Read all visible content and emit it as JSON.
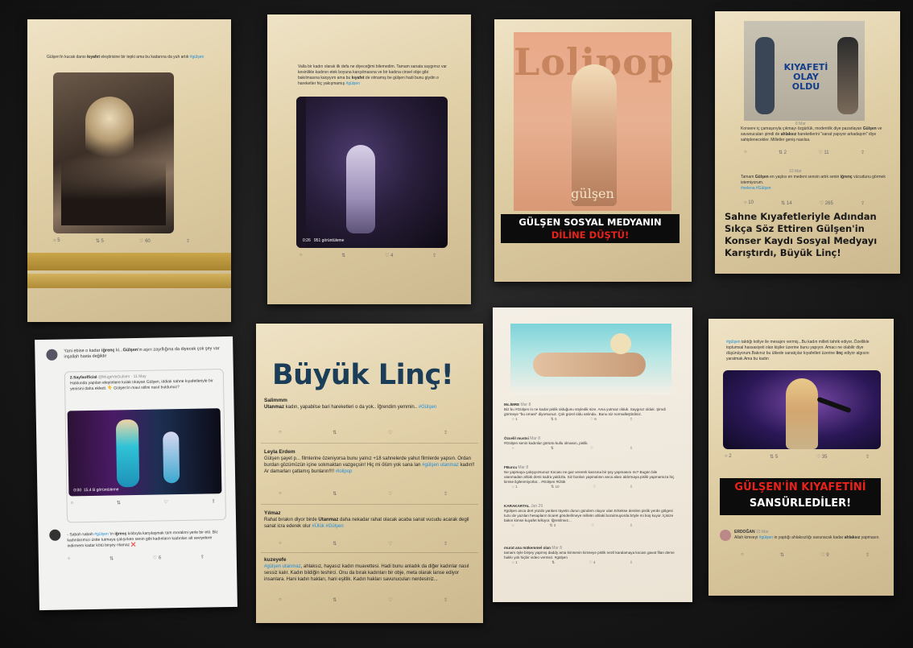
{
  "card1": {
    "tweet_pre": "Gülşen'in kucak dansı ",
    "tweet_bold": "kıyafet",
    "tweet_post": " eleştirisine bir tepki ama bu kadarına da yuh artık ",
    "hashtag": "#gülşen",
    "actions": [
      "5",
      "5",
      "60"
    ]
  },
  "card2": {
    "tweet_a": "Valla bir kadın olarak ilk defa ne diyeceğimi bilemedim. Tamam sanata saygımız var kesinlikle kadının etek boyuna karışılmasına ve bir kadına cinsel obje gibi bakılmasına karşıyım ama bu ",
    "tweet_bold": "kıyafet",
    "tweet_b": " de olmamış be gülşen hadi bunu giydin o hareketler hiç yakışmamış ",
    "hashtag": "#gülşen",
    "video_time": "0:26",
    "video_views": "951 görüntüleme"
  },
  "card3": {
    "logo": "Lolipop",
    "artist": "gülşen",
    "headline_line1": "GÜLŞEN SOSYAL MEDYANIN",
    "headline_line2": "DİLİNE DÜŞTÜ!"
  },
  "card4": {
    "banner_line1": "KIYAFETİ",
    "banner_line2": "OLAY OLDU",
    "date1": "8 Mar",
    "tweet1_a": "Konsere iç çamaşırıyla çıkmayı özgürlük, modernlik diye pazarlayan ",
    "tweet1_name": "Gülşen",
    "tweet1_b": " ve savunucuları şimdi de ",
    "tweet1_bold": "ahlaksız",
    "tweet1_c": " hareketlerini \"sanat yapıyor arkadaşım\" diye sahiplenecekler. Milletler geniş nasılsa.",
    "actions1": [
      "2",
      "11",
      ""
    ],
    "date2": "10 Mar",
    "tweet2_a": "Tamam ",
    "tweet2_name": "Gülşen",
    "tweet2_b": " en yaşlısı en medeni sensin artık senin ",
    "tweet2_bold": "iğrenç",
    "tweet2_c": " vücudunu görmek istemiyorum.",
    "tweet2_tags": "#selena #Gülşen",
    "actions2": [
      "10",
      "14",
      "265"
    ],
    "headline": "Sahne Kıyafetleriyle Adından Sıkça Söz Ettiren Gülşen'in Konser Kaydı Sosyal Medyayı Karıştırdı, Büyük Linç!"
  },
  "card5": {
    "tweet_a": "Yani ebise o kadar ",
    "tweet_bold": "iğrenç",
    "tweet_b": " ki...",
    "tweet_name": "Gülşen",
    "tweet_c": "'in aşırı zayıflığına da diyecek çok şey var inşallah hasta değildir",
    "quote_user": "2.Sayfaofficial",
    "quote_handle": "@MugeVeGulsen · 11 May",
    "quote_text": "Hakkında yapılan eleştirilere kulak tıkayan Gülşen, iddialı sahne kıyafetleriyle bir yenisini daha ekledi. 👇 Gülşen'in mavi stilini nasıl buldunuz?",
    "video_time": "0:00",
    "video_views": "15,4 B görüntüleme",
    "reply_a": "- Sabah sabah ",
    "reply_tag": "#gülşen",
    "reply_b": " 'in ",
    "reply_bold": "iğrenç",
    "reply_c": " kılıbıyla karşılaşmak tüm moralimi yerle bir etti. Biz kadınlarımızı üstte tutmaya çalışırken senin gibi kadınların kadınları alt seviyelere indirmem kadar kötü birşey olamaz ❌",
    "reply_actions": [
      "",
      "",
      "6"
    ]
  },
  "card6": {
    "title": "Büyük Linç!",
    "posts": [
      {
        "name": "Salimmm",
        "bold": "Utanmaz",
        "text": " kadın, yapabilse bari hareketleri o da yok.. İğrendim yemmin.. ",
        "tag": "#Gülşen"
      },
      {
        "name": "Leyla Erdem",
        "bold": "",
        "text": "Gülşen şayet p... filmlerine özeniyorsa bunu yalnız +18 sahnelerde yahut filmlerde yapsın. Ordan burdan gözümüzün içine sokmaktan vazgeçsin! Hiç mi ölüm yok sana lan ",
        "tag": "#gülşen utanmaz",
        "text2": " kadın!! Ar damarları çatlamış bunların!!!! ",
        "tag2": "#lolipop"
      },
      {
        "name": "Yılmaz",
        "bold": "",
        "text": "Rahat bırakın diyor birde ",
        "bold2": "Utanmaz",
        "text2": " daha nekadar rahat olacak acaba sanat vucudu acarak degil sanat icra ederek olur ",
        "tag": "#Ülük #Gülşen"
      },
      {
        "name": "kuzeyefe",
        "bold": "",
        "tag": "#gülşen utanmaz",
        "text": ", ahlaksız, hayasız kadın muavettesi. Hadi bunu anladık da diğer kadınlar nasıl sessiz kalır. Kadın bildiğin teshirci. Onu da bırak kadınları bir obje, meta olarak lanse ediyor insanlara. Hani kadın hakları, hani eşitlik. Kadın hakları savunucuları nerdesiniz..."
      }
    ]
  },
  "card7": {
    "posts": [
      {
        "name": "Mc.İMRE",
        "date": "Mar 8",
        "text": "Biz bu #Gülşen in ne kadar pislik olduğunu söyledik size. Ama yutmaz olduk. Saygısız olduk. Şimdi görmeye \"bu ornasi\" diyorsunuz. Çok güzel oldu aslında.. Bunu siz normalleştirdiniz.",
        "actions": [
          "1",
          "5",
          "6"
        ]
      },
      {
        "name": "Özcelil mustsi",
        "date": "Mar 8",
        "text": "#Gülşen senin kadınlar görünü kullu olmasın, pislik.",
        "actions": [
          "",
          "",
          ""
        ]
      },
      {
        "name": "FBurcu",
        "date": "Mar 8",
        "text": "Ne yapmaya çalışıyorsunuz Kocası ne gaz vererek karısına bir şey yapmasını mı? Bugün bile utanmadan ahlak dersi sadra yaldızla. Siz bunları yapmalısın anca alanı aldırmaya pislik yapmamıza hiç kimse ilgilenmiyorlar... #Gülşen #Ülük",
        "actions": [
          "1",
          "10",
          ""
        ]
      },
      {
        "name": "KARAKARTAL",
        "date": "Jan 29",
        "text": "#gülşen anca dert yüzdü yanken tüyetin durun gündem oluyor ulan Erkekse denilen pislik yerde gölgesi tuzu de yazılan hesapların ticaret gönderilmeye milletin ahlaki bozulmuyorda böyle mi boş kuyor. İçinize bakın kimse kuyafet kılkıyor. İğrenilmez...",
        "actions": [
          "",
          "3",
          ""
        ]
      },
      {
        "name": "murat ana mükemmel olan",
        "date": "Mar 8",
        "text": "tamam öyle birşey yapmış daddy ama kimsenin kimseye pislik nezil karalamaya kocası gavat filan deme hakkı yok hiçbir video vermez. #gülşen",
        "actions": [
          "1",
          "",
          "4"
        ]
      }
    ]
  },
  "card8": {
    "tweet_a": "",
    "tweet_tag": "#gülşen",
    "tweet_b": " taktığı koliye ile mesajını vermiş...Bu kadın milleti tahrik ediyor..Özellikle toplumsal hassasiyeti olan kişiler üzerine bunu yapıyor. Amacı ne olabilir diye düşünüyorum.Bakınız bu ülkede sanatçılar kıyafetleri üzerine ",
    "tweet_bold": "linç",
    "tweet_c": " ediyor algısını yaratmak.Ama bu kadın",
    "actions": [
      "2",
      "5",
      "35"
    ],
    "headline_line1": "GÜLŞEN'İN KIYAFETİNİ",
    "headline_line2": "SANSÜRLEDİLER!",
    "reply_name": "ERDOĞAN",
    "reply_date": "10 Mar",
    "reply_a": "Allah kimseyi ",
    "reply_tag": "#gülşen",
    "reply_b": " in yaptığı ahlaksızlığı savunacak kadar ",
    "reply_bold": "ahlaksız",
    "reply_c": " yapmasın.",
    "reply_actions": [
      "",
      "",
      "9"
    ]
  }
}
